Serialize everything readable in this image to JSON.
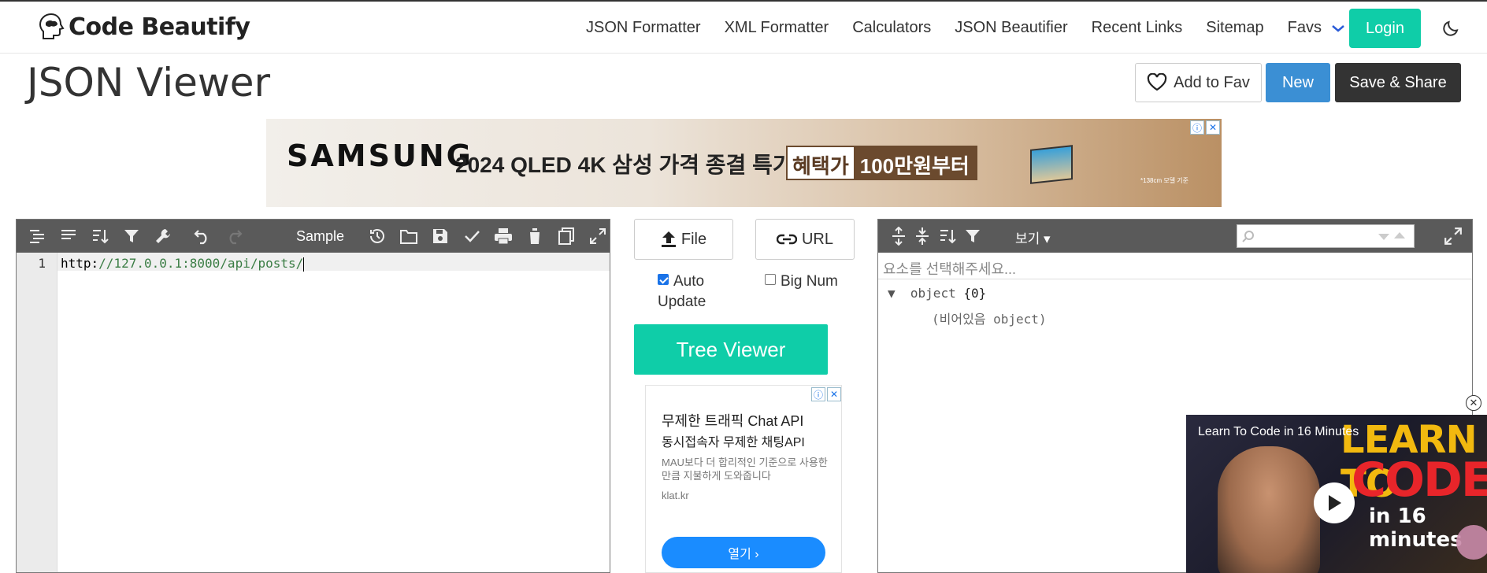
{
  "brand": {
    "name": "Code Beautify"
  },
  "nav": {
    "links": [
      "JSON Formatter",
      "XML Formatter",
      "Calculators",
      "JSON Beautifier",
      "Recent Links",
      "Sitemap"
    ],
    "favs_label": "Favs",
    "login_label": "Login"
  },
  "page": {
    "title": "JSON Viewer",
    "add_fav_label": "Add to Fav",
    "new_label": "New",
    "save_share_label": "Save & Share"
  },
  "banner_ad": {
    "brand": "SAMSUNG",
    "headline": "2024 QLED 4K 삼성 가격 종결 특가!",
    "tag_a": "혜택가",
    "tag_b": "100만원부터",
    "note": "*138cm 모델 기준"
  },
  "editor": {
    "sample_label": "Sample",
    "line_number": "1",
    "content_prefix": "http:",
    "content_literal": "//127.0.0.1:8000/api/posts/"
  },
  "middle": {
    "file_label": "File",
    "url_label": "URL",
    "auto_update_label": "Auto Update",
    "auto_update_checked": true,
    "big_num_label": "Big Num",
    "big_num_checked": false,
    "tree_viewer_label": "Tree Viewer"
  },
  "mini_ad": {
    "line1": "무제한 트래픽 Chat API",
    "line2": "동시접속자 무제한 채팅API",
    "desc": "MAU보다 더 합리적인 기준으로 사용한 만큼 지불하게 도와줍니다",
    "url": "klat.kr",
    "button": "열기 ›"
  },
  "viewer": {
    "view_label": "보기 ▾",
    "status_placeholder": "요소를 선택해주세요...",
    "root_key": "object",
    "root_count": "{0}",
    "empty_note": "(비어있음 object)"
  },
  "video": {
    "title": "Learn To Code in 16 Minutes",
    "thumb_line1": "LEARN TO",
    "thumb_line2": "CODE",
    "thumb_line3": "in 16 minutes"
  },
  "colors": {
    "accent": "#0fcda8",
    "primary_blue": "#3b8fd4",
    "dark": "#333333",
    "toolbar": "#5a5a5a"
  }
}
